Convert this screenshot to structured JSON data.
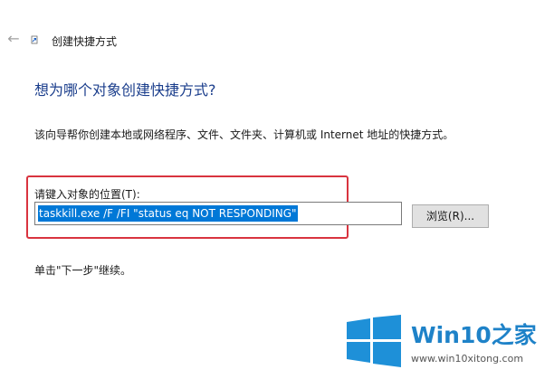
{
  "wizard": {
    "title": "创建快捷方式",
    "back_icon": "arrow-left-icon",
    "heading": "想为哪个对象创建快捷方式?",
    "description": "该向导帮你创建本地或网络程序、文件、文件夹、计算机或 Internet 地址的快捷方式。",
    "location_label": "请键入对象的位置(T):",
    "location_value": "taskkill.exe /F /FI \"status eq NOT RESPONDING\"",
    "browse_label": "浏览(R)...",
    "hint": "单击\"下一步\"继续。"
  },
  "watermark": {
    "brand": "Win10之家",
    "url": "www.win10xitong.com"
  },
  "colors": {
    "heading": "#1b3e8c",
    "selection": "#0078d7",
    "highlight_box": "#d9343f",
    "brand": "#1e82c8"
  }
}
